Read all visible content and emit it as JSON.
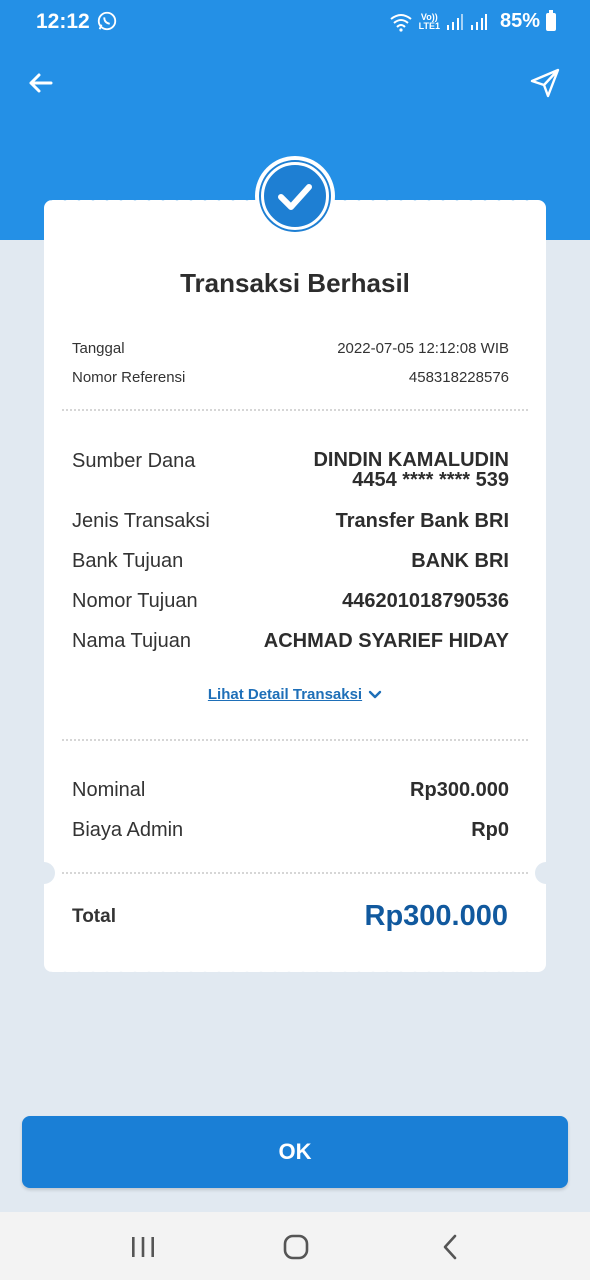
{
  "status_bar": {
    "time": "12:12",
    "network_top": "Vo))",
    "network_bottom": "LTE1",
    "battery": "85%"
  },
  "header": {
    "back_icon": "arrow-left-icon",
    "share_icon": "send-icon"
  },
  "receipt": {
    "title": "Transaksi Berhasil",
    "meta": [
      {
        "label": "Tanggal",
        "value": "2022-07-05 12:12:08 WIB"
      },
      {
        "label": "Nomor Referensi",
        "value": "458318228576"
      }
    ],
    "source": {
      "label": "Sumber Dana",
      "name": "DINDIN KAMALUDIN",
      "card": "4454 **** **** 539"
    },
    "details": [
      {
        "label": "Jenis Transaksi",
        "value": "Transfer Bank BRI"
      },
      {
        "label": "Bank Tujuan",
        "value": "BANK BRI"
      },
      {
        "label": "Nomor Tujuan",
        "value": "446201018790536"
      },
      {
        "label": "Nama Tujuan",
        "value": "ACHMAD SYARIEF HIDAY"
      }
    ],
    "detail_link": "Lihat Detail Transaksi",
    "amounts": [
      {
        "label": "Nominal",
        "value": "Rp300.000"
      },
      {
        "label": "Biaya Admin",
        "value": "Rp0"
      }
    ],
    "total": {
      "label": "Total",
      "value": "Rp300.000"
    }
  },
  "ok_button": "OK",
  "colors": {
    "primary": "#2490e6",
    "button": "#1a7fd6",
    "total": "#11599e",
    "link": "#1e6fb8",
    "background": "#e1e9f1"
  }
}
